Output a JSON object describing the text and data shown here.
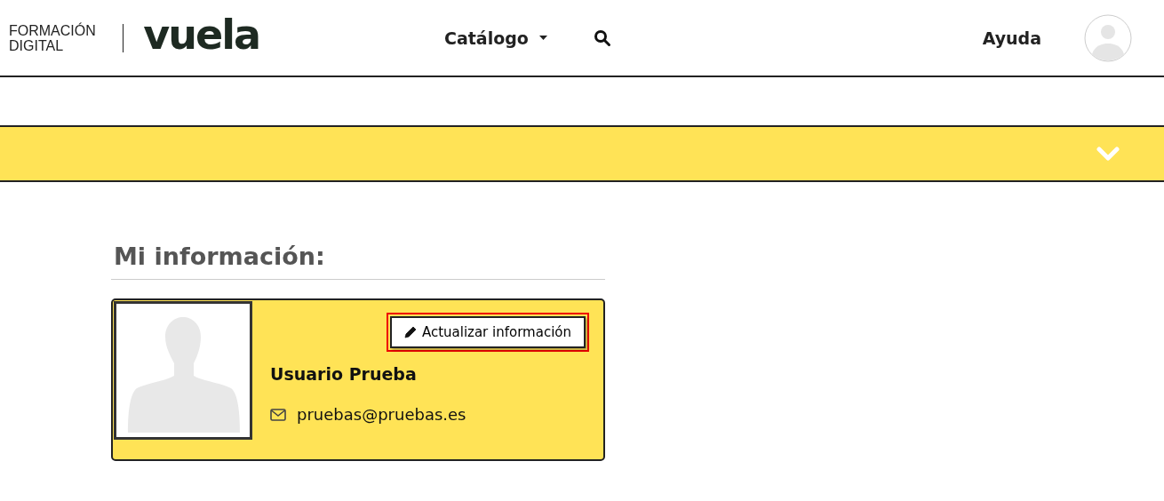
{
  "logo": {
    "tagline": [
      "FORMACIÓN",
      "DIGITAL"
    ],
    "wordmark": "vuela"
  },
  "nav": {
    "catalog": "Catálogo",
    "help": "Ayuda"
  },
  "collapse_bar": {
    "expanded": false
  },
  "section": {
    "title": "Mi información:"
  },
  "profile": {
    "update_button": {
      "label": "Actualizar información",
      "highlighted": true
    },
    "name": "Usuario Prueba",
    "email": "pruebas@pruebas.es"
  }
}
